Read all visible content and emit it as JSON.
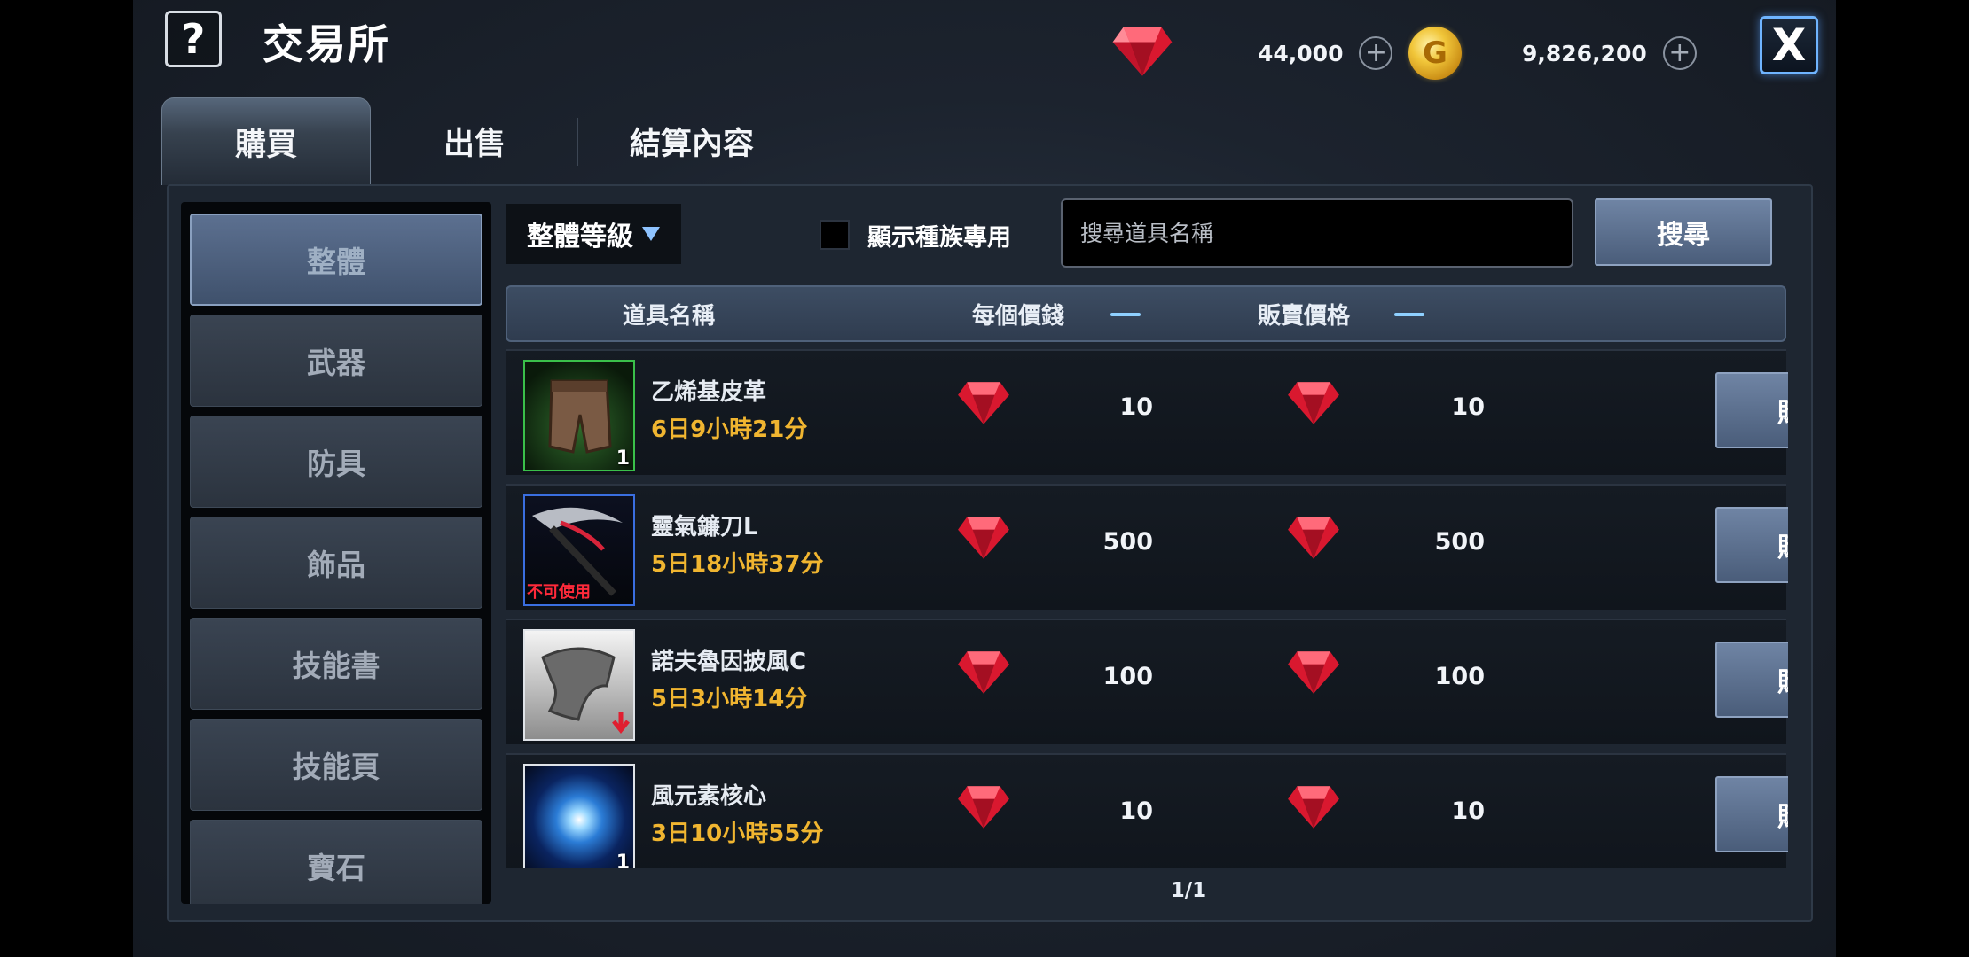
{
  "header": {
    "help_label": "?",
    "title": "交易所",
    "ruby_amount": "44,000",
    "gold_amount": "9,826,200",
    "close_label": "X",
    "coin_glyph": "G"
  },
  "tabs": [
    {
      "label": "購買",
      "active": true
    },
    {
      "label": "出售",
      "active": false
    },
    {
      "label": "結算內容",
      "active": false
    }
  ],
  "categories": [
    {
      "label": "整體",
      "active": true
    },
    {
      "label": "武器",
      "active": false
    },
    {
      "label": "防具",
      "active": false
    },
    {
      "label": "飾品",
      "active": false
    },
    {
      "label": "技能書",
      "active": false
    },
    {
      "label": "技能頁",
      "active": false
    },
    {
      "label": "寶石",
      "active": false
    }
  ],
  "filters": {
    "grade_selected": "整體等級",
    "race_only_label": "顯示種族專用",
    "race_only_checked": false,
    "search_placeholder": "搜尋道具名稱",
    "search_button": "搜尋"
  },
  "table": {
    "col_name": "道具名稱",
    "col_unit_price": "每個價錢",
    "col_sale_price": "販賣價格"
  },
  "items": [
    {
      "name": "乙烯基皮革",
      "time_left": "6日9小時21分",
      "unit_price": "10",
      "sale_price": "10",
      "qty": "1",
      "frame": "green",
      "icon": "leather-pants-icon",
      "buy_label": "購買"
    },
    {
      "name": "靈氣鐮刀L",
      "time_left": "5日18小時37分",
      "unit_price": "500",
      "sale_price": "500",
      "qty": "",
      "frame": "blue",
      "icon": "scythe-icon",
      "tag": "不可使用",
      "buy_label": "購買"
    },
    {
      "name": "諾夫魯因披風C",
      "time_left": "5日3小時14分",
      "unit_price": "100",
      "sale_price": "100",
      "qty": "",
      "frame": "white",
      "icon": "cloak-icon",
      "buy_label": "購買"
    },
    {
      "name": "風元素核心",
      "time_left": "3日10小時55分",
      "unit_price": "10",
      "sale_price": "10",
      "qty": "1",
      "frame": "space",
      "icon": "wind-core-icon",
      "buy_label": "購買"
    }
  ],
  "pager": "1/1",
  "colors": {
    "accent_gold": "#f0b530",
    "ruby": "#e3213a",
    "button": "#5b6f8e",
    "close_glow": "#6fb4ff"
  }
}
